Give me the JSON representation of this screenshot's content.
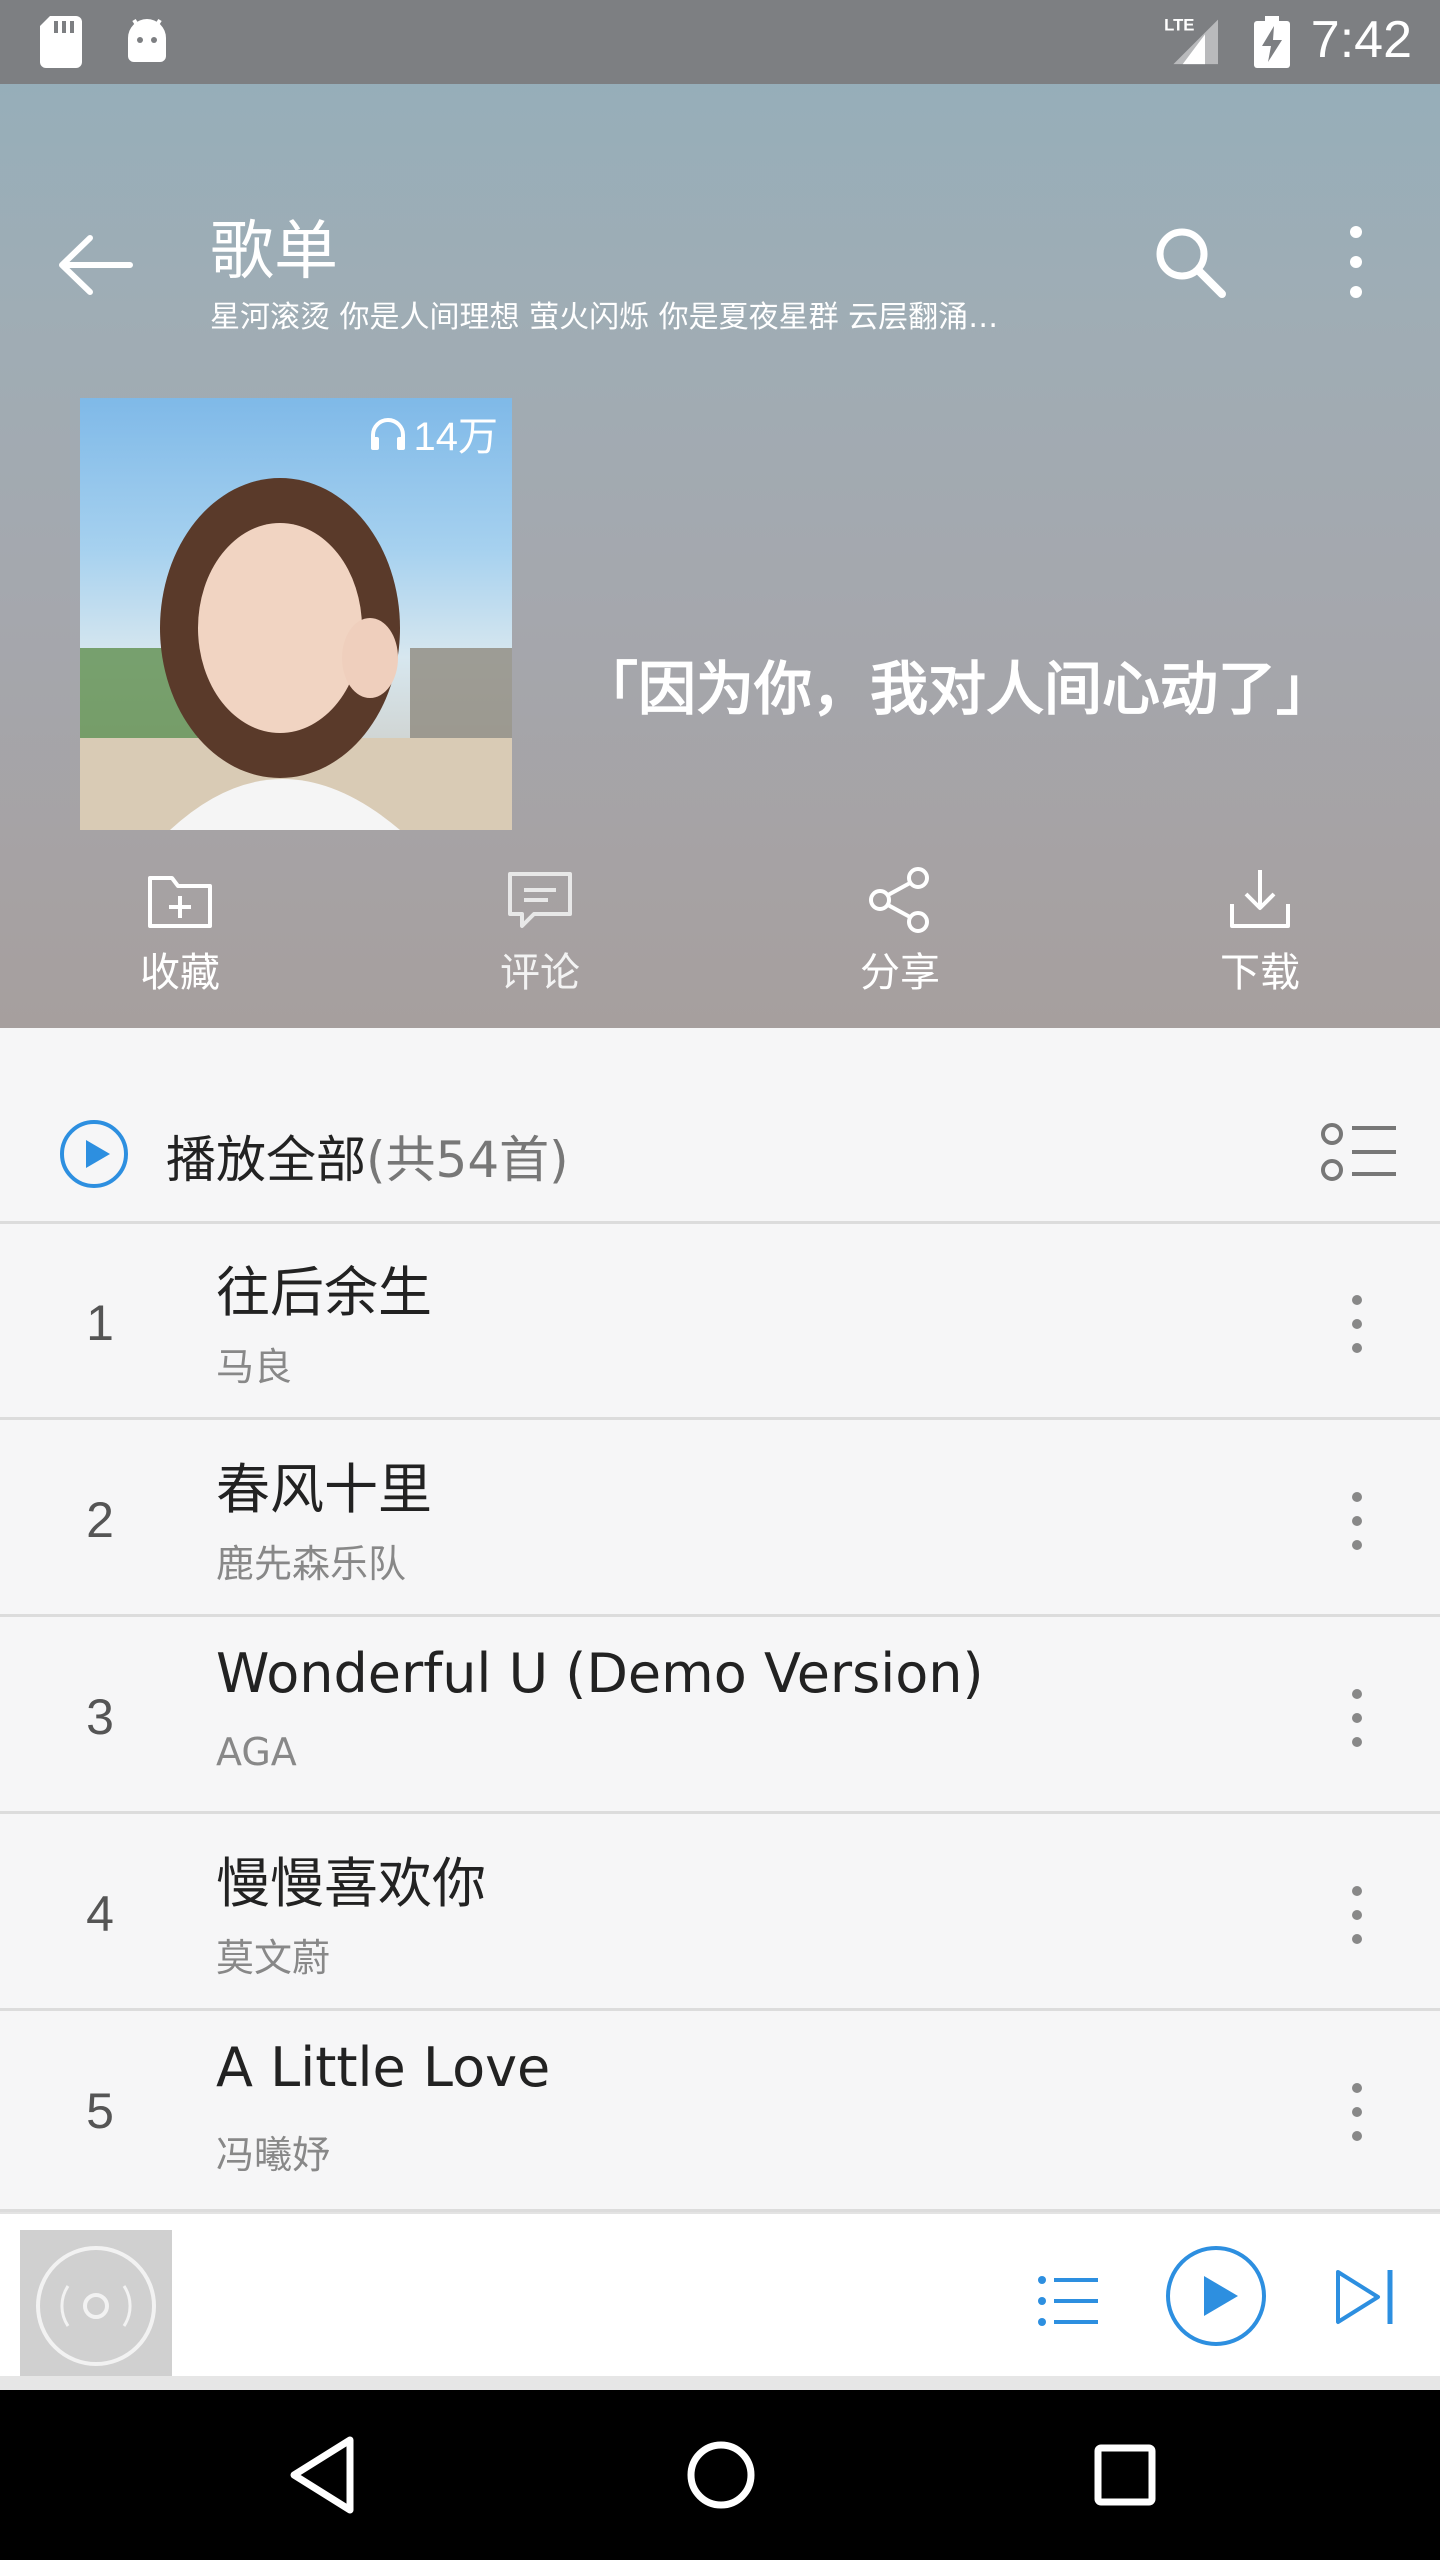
{
  "status_bar": {
    "time": "7:42",
    "network": "LTE"
  },
  "header": {
    "title": "歌单",
    "subtitle": "星河滚烫 你是人间理想 萤火闪烁 你是夏夜星群 云层翻涌…",
    "play_count": "14万",
    "quote": "「因为你，我对人间心动了」"
  },
  "actions": [
    {
      "label": "收藏",
      "icon": "folder-add-icon"
    },
    {
      "label": "评论",
      "icon": "comment-icon"
    },
    {
      "label": "分享",
      "icon": "share-icon"
    },
    {
      "label": "下载",
      "icon": "download-icon"
    }
  ],
  "play_all": {
    "label": "播放全部",
    "count": "(共54首)"
  },
  "songs": [
    {
      "index": "1",
      "title": "往后余生",
      "artist": "马良"
    },
    {
      "index": "2",
      "title": "春风十里",
      "artist": "鹿先森乐队"
    },
    {
      "index": "3",
      "title": "Wonderful U (Demo Version)",
      "artist": "AGA"
    },
    {
      "index": "4",
      "title": "慢慢喜欢你",
      "artist": "莫文蔚"
    },
    {
      "index": "5",
      "title": "A Little Love",
      "artist": "冯曦妤"
    }
  ],
  "colors": {
    "accent": "#2d8fe0",
    "header_top": "#93aebb",
    "header_bottom": "#a69f9e",
    "divider": "#dcdcdc"
  }
}
